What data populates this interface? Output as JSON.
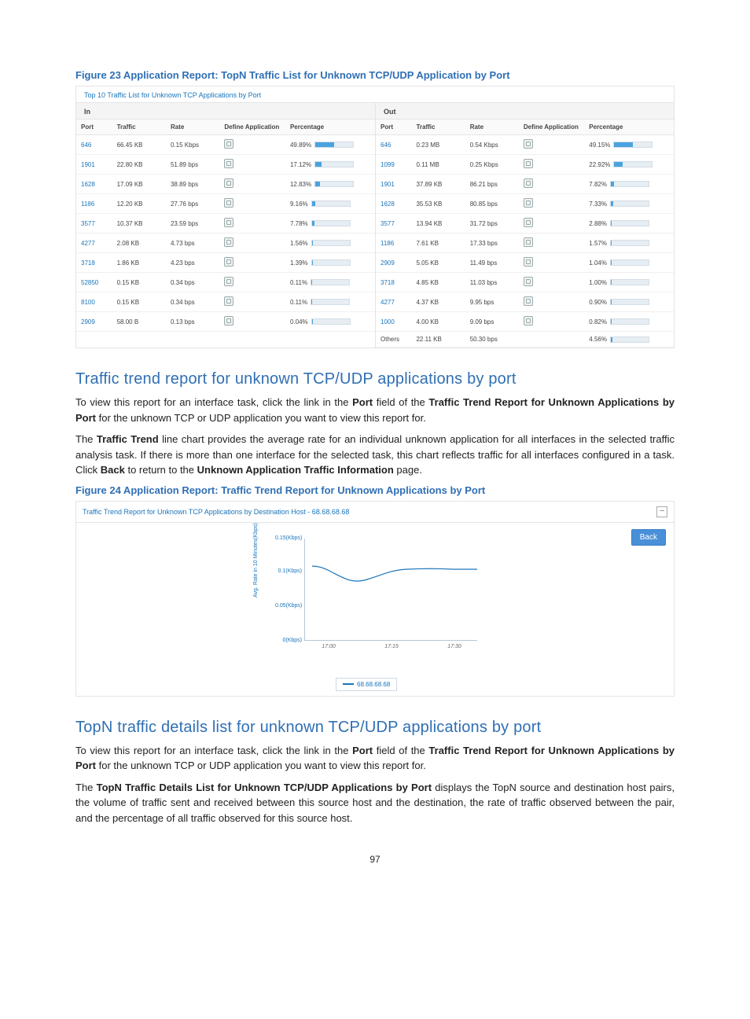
{
  "figure23": {
    "caption": "Figure 23 Application Report: TopN Traffic List for Unknown TCP/UDP Application by Port",
    "panel_title": "Top 10 Traffic List for Unknown TCP Applications by Port",
    "cols": [
      "Port",
      "Traffic",
      "Rate",
      "Define Application",
      "Percentage"
    ],
    "in_label": "In",
    "out_label": "Out",
    "in_rows": [
      {
        "port": "646",
        "traffic": "66.45 KB",
        "rate": "0.15 Kbps",
        "pct": "49.89%",
        "bar": 49.89
      },
      {
        "port": "1901",
        "traffic": "22.80 KB",
        "rate": "51.89 bps",
        "pct": "17.12%",
        "bar": 17.12
      },
      {
        "port": "1628",
        "traffic": "17.09 KB",
        "rate": "38.89 bps",
        "pct": "12.83%",
        "bar": 12.83
      },
      {
        "port": "1186",
        "traffic": "12.20 KB",
        "rate": "27.76 bps",
        "pct": "9.16%",
        "bar": 9.16
      },
      {
        "port": "3577",
        "traffic": "10.37 KB",
        "rate": "23.59 bps",
        "pct": "7.78%",
        "bar": 7.78
      },
      {
        "port": "4277",
        "traffic": "2.08 KB",
        "rate": "4.73 bps",
        "pct": "1.56%",
        "bar": 1.56
      },
      {
        "port": "3718",
        "traffic": "1.86 KB",
        "rate": "4.23 bps",
        "pct": "1.39%",
        "bar": 1.39
      },
      {
        "port": "52850",
        "traffic": "0.15 KB",
        "rate": "0.34 bps",
        "pct": "0.11%",
        "bar": 0.11
      },
      {
        "port": "8100",
        "traffic": "0.15 KB",
        "rate": "0.34 bps",
        "pct": "0.11%",
        "bar": 0.11
      },
      {
        "port": "2909",
        "traffic": "58.00 B",
        "rate": "0.13 bps",
        "pct": "0.04%",
        "bar": 0.04
      }
    ],
    "out_rows": [
      {
        "port": "646",
        "traffic": "0.23 MB",
        "rate": "0.54 Kbps",
        "pct": "49.15%",
        "bar": 49.15,
        "link": true
      },
      {
        "port": "1099",
        "traffic": "0.11 MB",
        "rate": "0.25 Kbps",
        "pct": "22.92%",
        "bar": 22.92,
        "link": true
      },
      {
        "port": "1901",
        "traffic": "37.89 KB",
        "rate": "86.21 bps",
        "pct": "7.82%",
        "bar": 7.82,
        "link": true
      },
      {
        "port": "1628",
        "traffic": "35.53 KB",
        "rate": "80.85 bps",
        "pct": "7.33%",
        "bar": 7.33,
        "link": true
      },
      {
        "port": "3577",
        "traffic": "13.94 KB",
        "rate": "31.72 bps",
        "pct": "2.88%",
        "bar": 2.88,
        "link": true
      },
      {
        "port": "1186",
        "traffic": "7.61 KB",
        "rate": "17.33 bps",
        "pct": "1.57%",
        "bar": 1.57,
        "link": true
      },
      {
        "port": "2909",
        "traffic": "5.05 KB",
        "rate": "11.49 bps",
        "pct": "1.04%",
        "bar": 1.04,
        "link": true
      },
      {
        "port": "3718",
        "traffic": "4.85 KB",
        "rate": "11.03 bps",
        "pct": "1.00%",
        "bar": 1.0,
        "link": true
      },
      {
        "port": "4277",
        "traffic": "4.37 KB",
        "rate": "9.95 bps",
        "pct": "0.90%",
        "bar": 0.9,
        "link": true
      },
      {
        "port": "1000",
        "traffic": "4.00 KB",
        "rate": "9.09 bps",
        "pct": "0.82%",
        "bar": 0.82,
        "link": true
      },
      {
        "port": "Others",
        "traffic": "22.11 KB",
        "rate": "50.30 bps",
        "pct": "4.56%",
        "bar": 4.56,
        "link": false
      }
    ]
  },
  "section1": {
    "heading": "Traffic trend report for unknown TCP/UDP applications by port",
    "p1a": "To view this report for an interface task, click the link in the ",
    "p1b": "Port",
    "p1c": " field of the ",
    "p1d": "Traffic Trend Report for Unknown Applications by Port",
    "p1e": " for the unknown TCP or UDP application you want to view this report for.",
    "p2a": "The ",
    "p2b": "Traffic Trend",
    "p2c": " line chart provides the average rate for an individual unknown application for all interfaces in the selected traffic analysis task. If there is more than one interface for the selected task, this chart reflects traffic for all interfaces configured in a task. Click ",
    "p2d": "Back",
    "p2e": " to return to the ",
    "p2f": "Unknown Application Traffic Information",
    "p2g": " page."
  },
  "figure24": {
    "caption": "Figure 24 Application Report: Traffic Trend Report for Unknown Applications by Port",
    "panel_title": "Traffic Trend Report for Unknown TCP Applications by Destination Host - 68.68.68.68",
    "back_label": "Back",
    "ylabel": "Avg. Rate in 10 Minutes(Kbps)",
    "legend": "68.68.68.68",
    "collapse_symbol": "–"
  },
  "chart_data": {
    "type": "line",
    "title": "Traffic Trend Report for Unknown TCP Applications by Destination Host - 68.68.68.68",
    "xlabel": "",
    "ylabel": "Avg. Rate in 10 Minutes(Kbps)",
    "x": [
      "17:00",
      "17:15",
      "17:30"
    ],
    "x_ticks": [
      "17:00",
      "17:15",
      "17:30"
    ],
    "y_ticks": [
      0,
      0.05,
      0.1,
      0.15
    ],
    "y_tick_labels": [
      "0(Kbps)",
      "0.05(Kbps)",
      "0.1(Kbps)",
      "0.15(Kbps)"
    ],
    "ylim": [
      0,
      0.15
    ],
    "series": [
      {
        "name": "68.68.68.68",
        "values": [
          0.11,
          0.09,
          0.105
        ]
      }
    ],
    "legend_position": "bottom"
  },
  "section2": {
    "heading": "TopN traffic details list for unknown TCP/UDP applications by port",
    "p1a": "To view this report for an interface task, click the link in the ",
    "p1b": "Port",
    "p1c": " field of the ",
    "p1d": "Traffic Trend Report for Unknown Applications by Port",
    "p1e": " for the unknown TCP or UDP application you want to view this report for.",
    "p2a": "The ",
    "p2b": "TopN Traffic Details List for Unknown TCP/UDP Applications by Port",
    "p2c": " displays the TopN source and destination host pairs, the volume of traffic sent and received between this source host and the destination, the rate of traffic observed between the pair, and the percentage of all traffic observed for this source host."
  },
  "page_number": "97"
}
